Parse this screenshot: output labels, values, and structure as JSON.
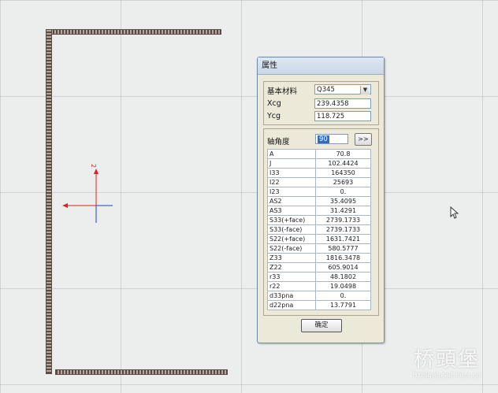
{
  "dialog": {
    "title": "属性",
    "base_material_label": "基本材料",
    "base_material_value": "Q345",
    "xcg_label": "Xcg",
    "xcg_value": "239.4358",
    "ycg_label": "Ycg",
    "ycg_value": "118.725",
    "axis_angle_label": "轴角度",
    "axis_angle_value": "90",
    "more_button_label": ">>",
    "ok_button_label": "确定",
    "properties": [
      {
        "name": "A",
        "value": "70.8"
      },
      {
        "name": "J",
        "value": "102.4424"
      },
      {
        "name": "I33",
        "value": "164350"
      },
      {
        "name": "I22",
        "value": "25693"
      },
      {
        "name": "I23",
        "value": "0."
      },
      {
        "name": "AS2",
        "value": "35.4095"
      },
      {
        "name": "AS3",
        "value": "31.4291"
      },
      {
        "name": "S33(+face)",
        "value": "2739.1733"
      },
      {
        "name": "S33(-face)",
        "value": "2739.1733"
      },
      {
        "name": "S22(+face)",
        "value": "1631.7421"
      },
      {
        "name": "S22(-face)",
        "value": "580.5777"
      },
      {
        "name": "Z33",
        "value": "1816.3478"
      },
      {
        "name": "Z22",
        "value": "605.9014"
      },
      {
        "name": "r33",
        "value": "48.1802"
      },
      {
        "name": "r22",
        "value": "19.0498"
      },
      {
        "name": "d33pna",
        "value": "0."
      },
      {
        "name": "d22pna",
        "value": "13.7791"
      }
    ]
  },
  "axes": {
    "vertical_label": "2"
  },
  "watermark": {
    "cn": "桥頭堡",
    "en": "Bridgehead.com.cn"
  },
  "colors": {
    "accent": "#316ac5",
    "axis_red": "#e02020",
    "axis_blue": "#2040d0"
  }
}
